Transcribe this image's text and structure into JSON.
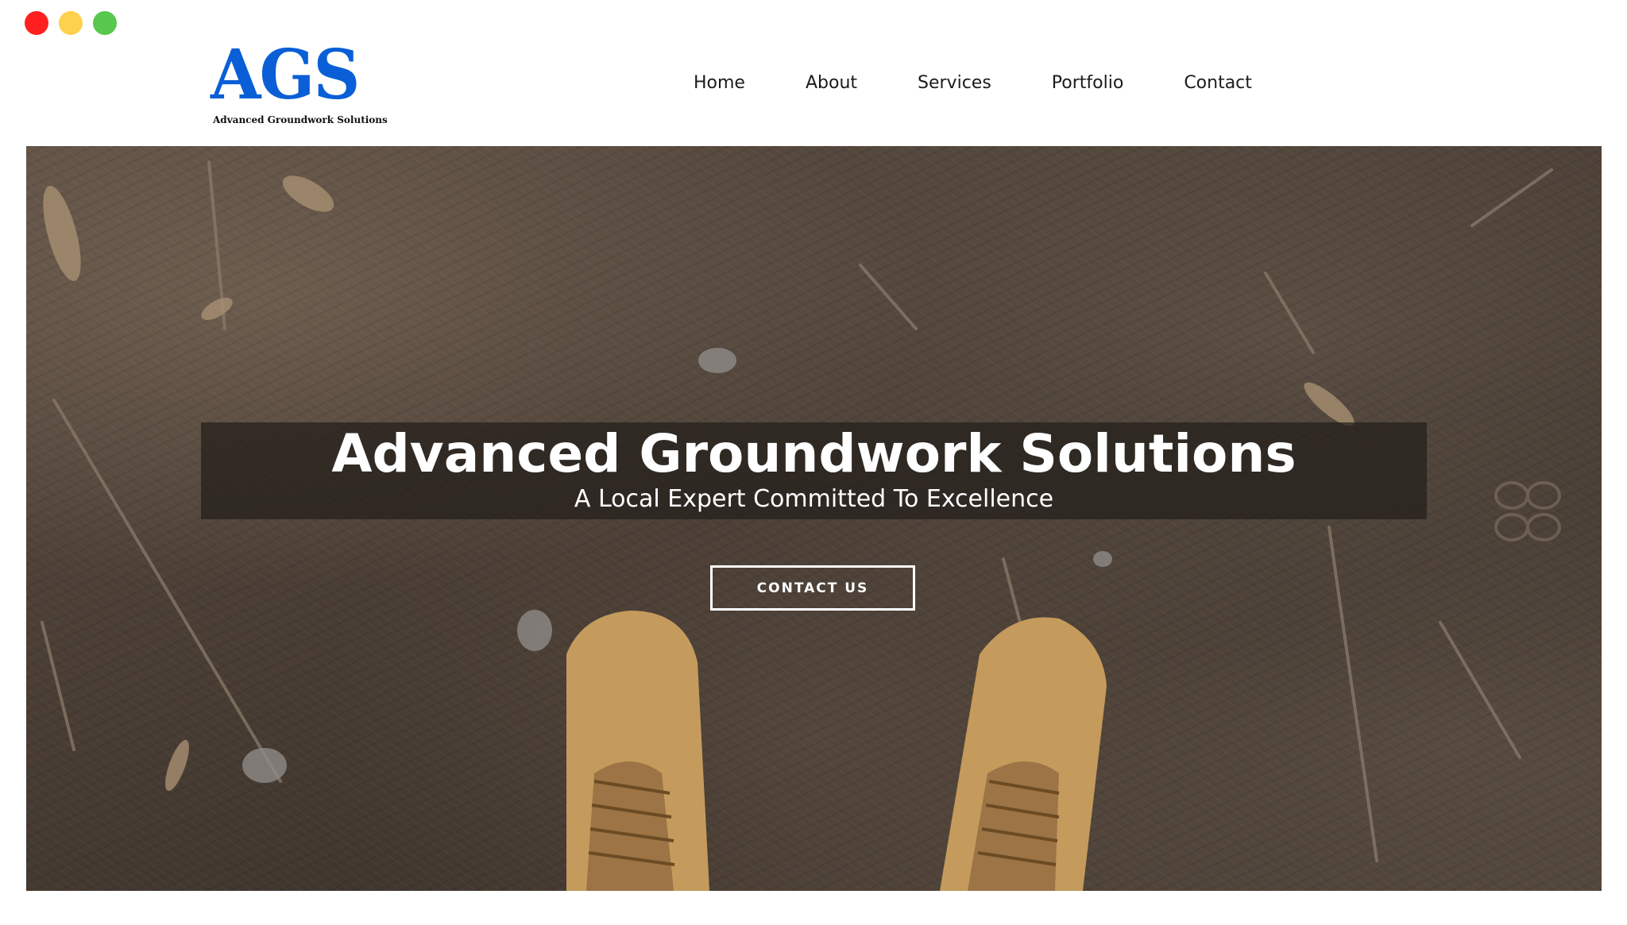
{
  "window": {
    "controls": [
      "close",
      "minimize",
      "zoom"
    ]
  },
  "header": {
    "logo": {
      "mark": "AGS",
      "tagline": "Advanced Groundwork Solutions"
    },
    "nav": [
      {
        "label": "Home"
      },
      {
        "label": "About"
      },
      {
        "label": "Services"
      },
      {
        "label": "Portfolio"
      },
      {
        "label": "Contact"
      }
    ]
  },
  "hero": {
    "title": "Advanced Groundwork Solutions",
    "subtitle": "A Local Expert Committed To Excellence",
    "cta_label": "CONTACT US",
    "background": "photo-dirt-ground-work-boots"
  },
  "colors": {
    "brand_blue": "#0a5fd6",
    "close": "#ff1f1f",
    "minimize": "#fdd14d",
    "zoom": "#57c84d"
  }
}
